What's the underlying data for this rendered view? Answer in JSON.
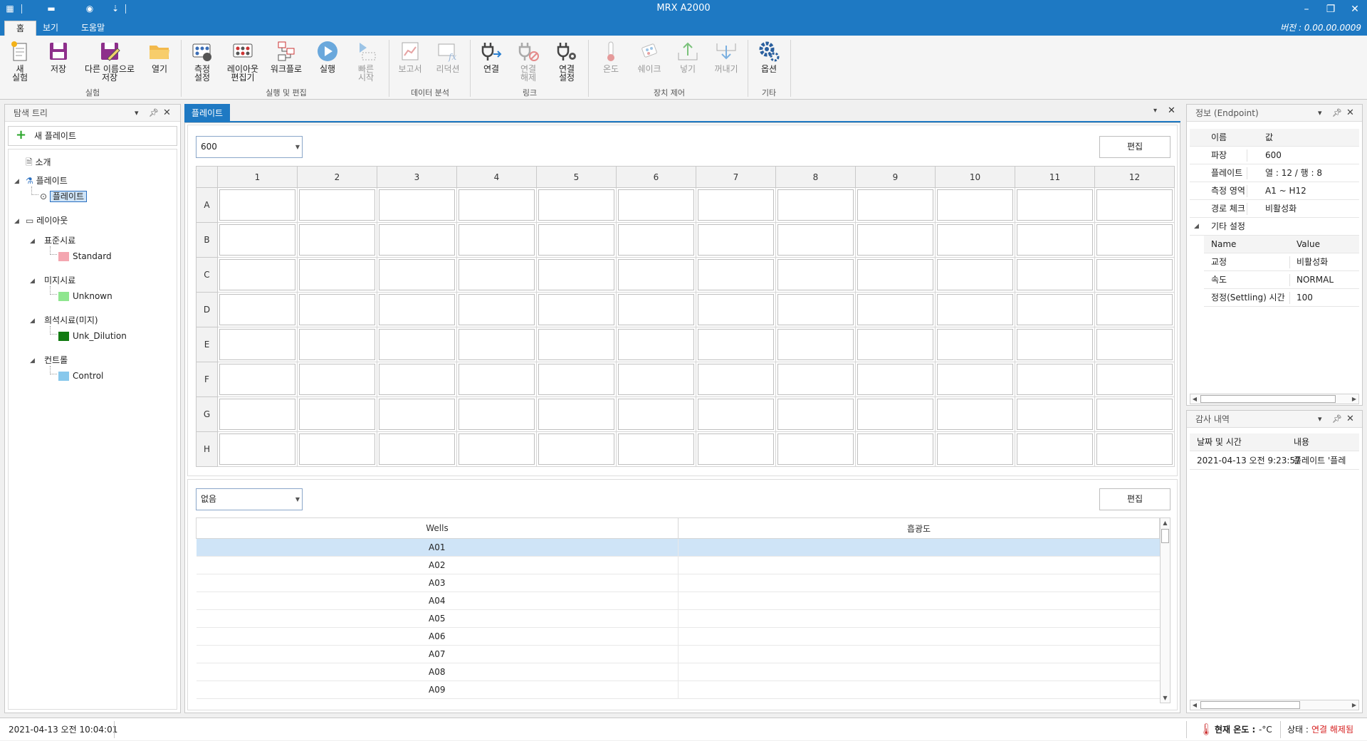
{
  "app": {
    "title": "MRX A2000",
    "version": "버전 : 0.00.00.0009"
  },
  "tabs": [
    "홈",
    "보기",
    "도움말"
  ],
  "ribbon": {
    "buttons": [
      "새\n실험",
      "저장",
      "다른 이름으로\n저장",
      "열기",
      "측정\n설정",
      "레이아웃\n편집기",
      "워크플로",
      "실행",
      "빠른\n시작",
      "보고서",
      "리덕션",
      "연결",
      "연결\n해제",
      "연결\n설정",
      "온도",
      "쉐이크",
      "넣기",
      "꺼내기",
      "옵션"
    ],
    "groups": [
      "실험",
      "실행 및 편집",
      "데이터 분석",
      "링크",
      "장치 제어",
      "기타"
    ]
  },
  "tree": {
    "title": "탐색 트리",
    "new_plate": "새 플레이트",
    "intro": "소개",
    "plate_root": "플레이트",
    "plate_child": "플레이트",
    "layout": "레이아웃",
    "standard_group": "표준시료",
    "standard": "Standard",
    "unknown_group": "미지시료",
    "unknown": "Unknown",
    "dilution_group": "희석시료(미지)",
    "dilution": "Unk_Dilution",
    "control_group": "컨트롤",
    "control": "Control"
  },
  "colors": {
    "standard": "#f4a6b0",
    "unknown": "#8fe68f",
    "dilution": "#117a11",
    "control": "#88c8ec",
    "accent": "#1e79c3",
    "status_red": "#d62020"
  },
  "doc": {
    "tab": "플레이트",
    "wavelength": "600",
    "edit": "편집",
    "columns": [
      "1",
      "2",
      "3",
      "4",
      "5",
      "6",
      "7",
      "8",
      "9",
      "10",
      "11",
      "12"
    ],
    "rows": [
      "A",
      "B",
      "C",
      "D",
      "E",
      "F",
      "G",
      "H"
    ],
    "lower_select": "없음",
    "lower_edit": "편집",
    "wells_header": "Wells",
    "absorbance_header": "흡광도",
    "wells": [
      "A01",
      "A02",
      "A03",
      "A04",
      "A05",
      "A06",
      "A07",
      "A08",
      "A09"
    ]
  },
  "info": {
    "title": "정보 (Endpoint)",
    "head_name": "이름",
    "head_value": "값",
    "rows": [
      {
        "k": "파장",
        "v": "600"
      },
      {
        "k": "플레이트",
        "v": "열 : 12 / 행 : 8"
      },
      {
        "k": "측정 영역",
        "v": "A1 ~ H12"
      },
      {
        "k": "경로 체크",
        "v": "비활성화"
      }
    ],
    "other": "기타 설정",
    "sub_name": "Name",
    "sub_value": "Value",
    "sub_rows": [
      {
        "k": "교정",
        "v": "비활성화"
      },
      {
        "k": "속도",
        "v": "NORMAL"
      },
      {
        "k": "정정(Settling) 시간",
        "v": "100"
      }
    ]
  },
  "audit": {
    "title": "감사 내역",
    "col_date": "날짜 및 시간",
    "col_content": "내용",
    "date": "2021-04-13 오전 9:23:57",
    "content": "플레이트 '플레"
  },
  "status": {
    "datetime": "2021-04-13 오전 10:04:01",
    "temp_label": "현재 온도 :",
    "temp_value": "-°C",
    "state_label": "상태 :",
    "state_value": "연결 해제됨"
  }
}
